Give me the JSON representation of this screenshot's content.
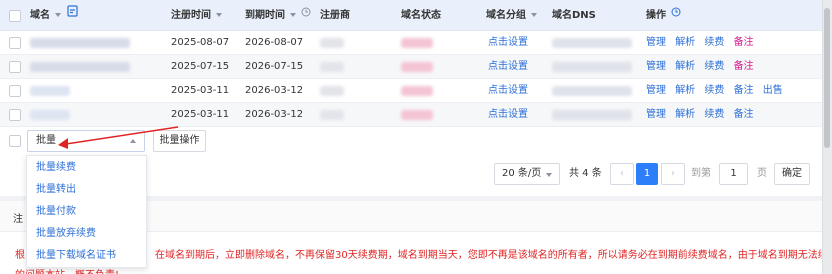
{
  "table": {
    "headers": {
      "domain": "域名",
      "register_time": "注册时间",
      "expire_time": "到期时间",
      "registrar": "注册商",
      "status": "域名状态",
      "group": "域名分组",
      "dns": "域名DNS",
      "actions": "操作"
    },
    "rows": [
      {
        "register": "2025-08-07",
        "expire": "2026-08-07",
        "group": "点击设置",
        "actions": [
          "管理",
          "解析",
          "续费",
          "备注"
        ]
      },
      {
        "register": "2025-07-15",
        "expire": "2026-07-15",
        "group": "点击设置",
        "actions": [
          "管理",
          "解析",
          "续费",
          "备注"
        ]
      },
      {
        "register": "2025-03-11",
        "expire": "2026-03-12",
        "group": "点击设置",
        "actions": [
          "管理",
          "解析",
          "续费",
          "备注",
          "出售"
        ]
      },
      {
        "register": "2025-03-11",
        "expire": "2026-03-12",
        "group": "点击设置",
        "actions": [
          "管理",
          "解析",
          "续费",
          "备注"
        ]
      }
    ]
  },
  "batch": {
    "select_value": "批量",
    "button": "批量操作",
    "options": [
      "批量续费",
      "批量转出",
      "批量付款",
      "批量放弃续费",
      "批量下载域名证书"
    ]
  },
  "pagination": {
    "page_size": "20 条/页",
    "total": "共 4 条",
    "current": "1",
    "goto_label": "到第",
    "goto_value": "1",
    "page_unit": "页",
    "confirm": "确定"
  },
  "notice": {
    "title": "注",
    "text_prefix": "根",
    "text": "在域名到期后，立即删除域名，不再保留30天续费期，域名到期当天，您即不再是该域名的所有者，所以请务必在到期前续费域名，由于域名到期无法续费导致",
    "text_line2": "的问题本站，概不负责!"
  },
  "colors": {
    "link": "#2d6fd6",
    "renew": "#d51a8a",
    "header_bg": "#eaf0fb",
    "accent": "#2d7ff9",
    "notice": "#e02424"
  }
}
